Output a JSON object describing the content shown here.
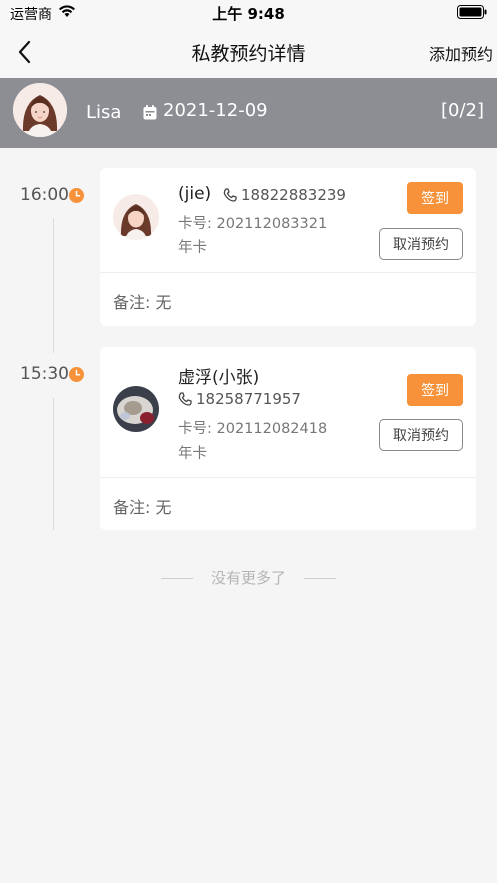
{
  "status_bar": {
    "carrier": "运营商",
    "time": "上午 9:48"
  },
  "nav": {
    "title": "私教预约详情",
    "action": "添加预约"
  },
  "header": {
    "coach_name": "Lisa",
    "date": "2021-12-09",
    "count": "[0/2]",
    "bg_color": "#8c8e93"
  },
  "appointments": [
    {
      "time": "16:00",
      "member_name": "(jie)",
      "phone": "18822883239",
      "card_no": "卡号: 202112083321",
      "card_type": "年卡",
      "checkin_label": "签到",
      "cancel_label": "取消预约",
      "note": "备注: 无"
    },
    {
      "time": "15:30",
      "member_name": "虚浮(小张)",
      "phone": "18258771957",
      "card_no": "卡号: 202112082418",
      "card_type": "年卡",
      "checkin_label": "签到",
      "cancel_label": "取消预约",
      "note": "备注: 无"
    }
  ],
  "footer": {
    "no_more": "没有更多了"
  },
  "colors": {
    "accent": "#f7923a",
    "page_bg": "#f5f5f5"
  },
  "icons": [
    "wifi-icon",
    "battery-icon",
    "back-arrow-icon",
    "calendar-icon",
    "clock-icon",
    "phone-icon"
  ]
}
